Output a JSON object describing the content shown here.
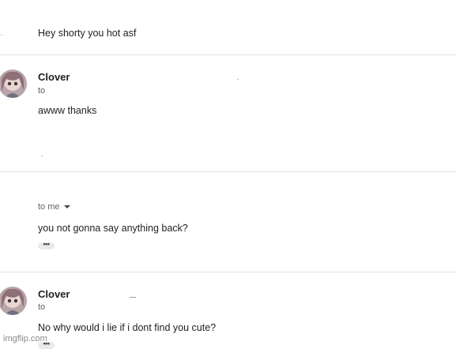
{
  "messages": [
    {
      "body": "Hey shorty you hot asf"
    },
    {
      "sender": "Clover",
      "recipient": "to",
      "body": "awww thanks"
    },
    {
      "recipient": "to me",
      "body": "you not gonna say anything back?"
    },
    {
      "sender": "Clover",
      "recipient": "to",
      "body": "No why would i lie if i dont find you cute?"
    }
  ],
  "watermark": "imgflip.com",
  "colors": {
    "divider": "#e3e3e3",
    "text": "#222222",
    "secondary_text": "#5f6368"
  }
}
